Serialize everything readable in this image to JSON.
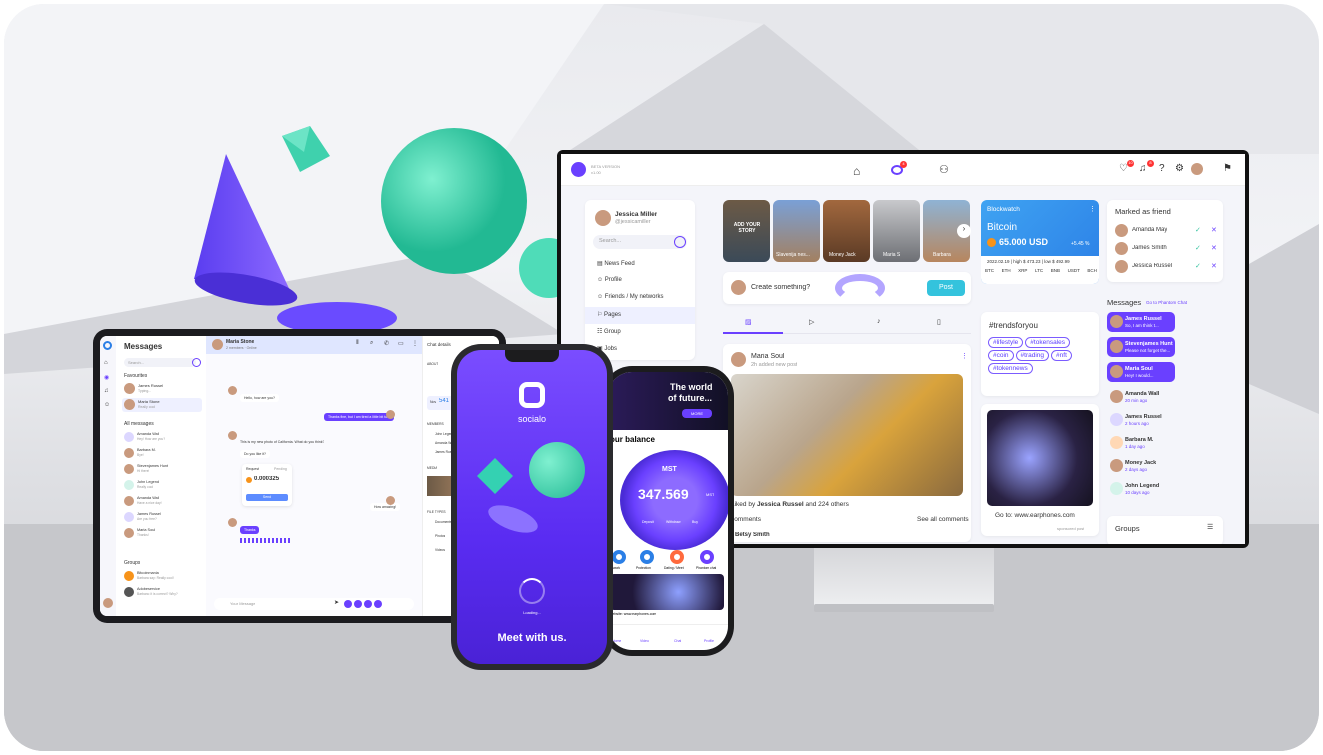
{
  "monitor": {
    "brand_line1": "BETA VERSION",
    "brand_line2": "v1.00",
    "profile_name": "Jessica Miller",
    "profile_handle": "@jessicamiller",
    "search_placeholder": "Search...",
    "menu": [
      "News Feed",
      "Profile",
      "Friends / My networks",
      "Pages",
      "Group",
      "Jobs"
    ],
    "stories": [
      "ADD YOUR STORY",
      "Slavenija nes...",
      "Money Jack",
      "Maria S",
      "Barbara"
    ],
    "create_placeholder": "Create something?",
    "post_button": "Post",
    "post_author": "Maria Soul",
    "post_meta": "2h  added new post",
    "liked_prefix": "Liked by ",
    "liked_name": "Jessica Russel",
    "liked_suffix": " and 224 others",
    "comments_label": "comments",
    "see_all": "See all comments",
    "commenter": "Betsy Smith",
    "crypto": {
      "title": "Blockwatch",
      "coin": "Bitcoin",
      "price": "65.000 USD",
      "change": "+5.45 %",
      "stats": "2022.02.19  |  high $ 473.23  |  low $ 492.99",
      "coins": [
        "BTC",
        "ETH",
        "XRP",
        "LTC",
        "BNB",
        "USDT",
        "BCH"
      ]
    },
    "trends_title": "#trendsforyou",
    "trends": [
      "#lifestyle",
      "#tokensales",
      "#coin",
      "#trading",
      "#nft",
      "#tokennews"
    ],
    "ad_caption": "Go to: www.earphones.com",
    "ad_sponsored": "sponsored post",
    "friends_title": "Marked as friend",
    "friends": [
      "Amanda May",
      "James Smith",
      "Jessica Russel"
    ],
    "messages_title": "Messages",
    "messages_link": "Go to Phantom Chat",
    "messages": [
      {
        "name": "James Russel",
        "text": "So, I am think t..."
      },
      {
        "name": "Stevenjames Hunt",
        "text": "Please not forget the..."
      },
      {
        "name": "Maria Soul",
        "text": "Hey! I would..."
      },
      {
        "name": "Amanda Wall",
        "text": "20 min ago"
      },
      {
        "name": "James Russel",
        "text": "2 hours ago"
      },
      {
        "name": "Barbara M.",
        "text": "1 day ago"
      },
      {
        "name": "Money Jack",
        "text": "2 days ago"
      },
      {
        "name": "John Legend",
        "text": "10 days ago"
      }
    ],
    "groups_title": "Groups",
    "badge_counts": [
      "4",
      "10",
      "8"
    ]
  },
  "tablet": {
    "title": "Messages",
    "search_placeholder": "Search...",
    "favourites": "Favourites",
    "favs": [
      {
        "name": "James Russel",
        "sub": "Typing..."
      },
      {
        "name": "Maria Stone",
        "sub": "Really cool"
      }
    ],
    "all_label": "All messages",
    "all": [
      {
        "name": "Amanda Wall",
        "sub": "Hey! How are you?"
      },
      {
        "name": "Barbara M.",
        "sub": "Bye!"
      },
      {
        "name": "Stevenjames Hunt",
        "sub": "Hi there!"
      },
      {
        "name": "John Legend",
        "sub": "Really cool"
      },
      {
        "name": "Amanda Wall",
        "sub": "Have a nice day!"
      },
      {
        "name": "James Russel",
        "sub": "Are you free?"
      },
      {
        "name": "Maria Soul",
        "sub": "Thanks!"
      }
    ],
    "groups_label": "Groups",
    "groups": [
      {
        "name": "Bitcoinmania",
        "sub": "Barbara say: Really cool!"
      },
      {
        "name": "Adobeservice",
        "sub": "Barbara: it is correct? Why?"
      }
    ],
    "chat_name": "Maria Stone",
    "chat_sub": "2 members · Online",
    "bubbles": [
      "Hello, how are you?",
      "Thanks fine, but I am tired a little bit too.",
      "This is my new photo of California. What do you think?",
      "Do you like it?",
      "How amazing!",
      "Thanks"
    ],
    "request_label": "Request",
    "request_status": "Pending",
    "request_amount": "0.000325",
    "request_btn": "Send",
    "input_placeholder": "Your Message",
    "details_title": "Chat details",
    "details_about": "ABOUT",
    "details_members": "MEMBERS",
    "details_media": "MEDIA",
    "details_files": "FILE TYPES",
    "nov_label": "Nov",
    "nov_value": "541",
    "members": [
      "John Legend",
      "Amanda Wall",
      "James Russel"
    ],
    "files": [
      "Documents",
      "Photos",
      "Videos"
    ]
  },
  "phone1": {
    "logo_text": "socialo",
    "loading": "Loading...",
    "tagline": "Meet with us."
  },
  "phone2": {
    "banner_line1": "The world",
    "banner_line2": "of future...",
    "banner_btn": "MORE",
    "balance_title": "our balance",
    "coin_name": "MST",
    "balance": "347.569",
    "balance_unit": "MST",
    "actions": [
      "Deposit",
      "Withdraw",
      "Buy"
    ],
    "features": [
      "Network",
      "Protection",
      "Dating / Meet",
      "Phantom chat"
    ],
    "ad_line": "website: www.earphones.com",
    "tabs": [
      "Home",
      "Video",
      "Chat",
      "Profile"
    ]
  },
  "colors": {
    "brand": "#6a40ff",
    "accent": "#34d1b2",
    "dark": "#1c1c1e"
  }
}
